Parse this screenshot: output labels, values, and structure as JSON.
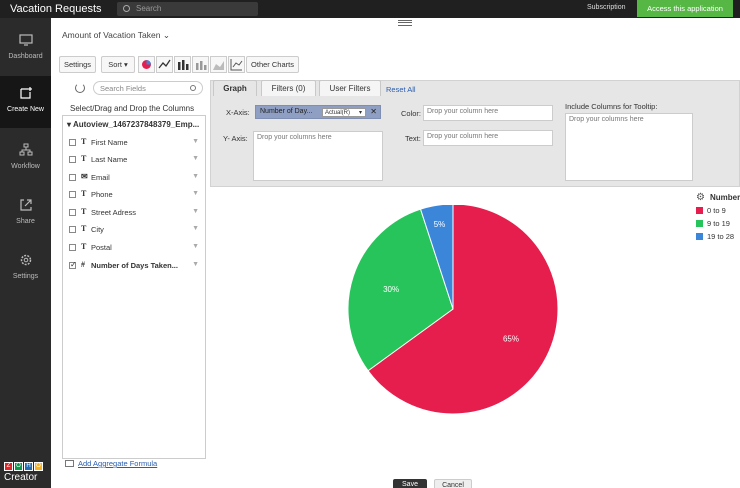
{
  "app": {
    "title": "Vacation Requests",
    "search_placeholder": "Search",
    "subscription": "Subscription",
    "access_button": "Access this application"
  },
  "nav": [
    {
      "label": "Dashboard",
      "icon": "monitor-icon"
    },
    {
      "label": "Create New",
      "icon": "create-new-icon"
    },
    {
      "label": "Workflow",
      "icon": "workflow-icon"
    },
    {
      "label": "Share",
      "icon": "share-icon"
    },
    {
      "label": "Settings",
      "icon": "gear-icon"
    }
  ],
  "brand": {
    "logo_letters": [
      "Z",
      "O",
      "H",
      "O"
    ],
    "product": "Creator"
  },
  "report": {
    "title": "Amount of Vacation Taken"
  },
  "toolbar": {
    "settings": "Settings",
    "sort": "Sort",
    "other_charts": "Other Charts"
  },
  "fields": {
    "search_placeholder": "Search Fields",
    "hint": "Select/Drag and Drop the Columns",
    "root": "Autoview_1467237848379_Emp...",
    "items": [
      {
        "label": "First Name",
        "type": "T",
        "checked": false
      },
      {
        "label": "Last Name",
        "type": "T",
        "checked": false
      },
      {
        "label": "Email",
        "type": "mail",
        "checked": false
      },
      {
        "label": "Phone",
        "type": "T",
        "checked": false
      },
      {
        "label": "Street Adress",
        "type": "T",
        "checked": false
      },
      {
        "label": "City",
        "type": "T",
        "checked": false
      },
      {
        "label": "Postal",
        "type": "T",
        "checked": false
      },
      {
        "label": "Number of Days Taken...",
        "type": "#",
        "checked": true
      }
    ],
    "add_aggregate": "Add Aggregate Formula"
  },
  "config": {
    "tabs": [
      "Graph",
      "Filters (0)",
      "User Filters"
    ],
    "reset": "Reset All",
    "x_axis_label": "X-Axis:",
    "x_axis_value": "Number of Day...",
    "x_axis_agg": "Actual(R)",
    "y_axis_label": "Y- Axis:",
    "y_axis_placeholder": "Drop your columns here",
    "color_label": "Color:",
    "color_placeholder": "Drop your column here",
    "text_label": "Text:",
    "text_placeholder": "Drop your column here",
    "tooltip_label": "Include Columns for Tooltip:",
    "tooltip_placeholder": "Drop your columns here"
  },
  "legend": {
    "title": "Number"
  },
  "chart_data": {
    "type": "pie",
    "categories": [
      "0 to 9",
      "9 to 19",
      "19 to 28"
    ],
    "values": [
      65,
      30,
      5
    ],
    "labels": [
      "65%",
      "30%",
      "5%"
    ],
    "colors": [
      "#e61e4d",
      "#27c45b",
      "#3c86d9"
    ],
    "legend_placement": "right"
  },
  "footer": {
    "save": "Save",
    "cancel": "Cancel"
  }
}
